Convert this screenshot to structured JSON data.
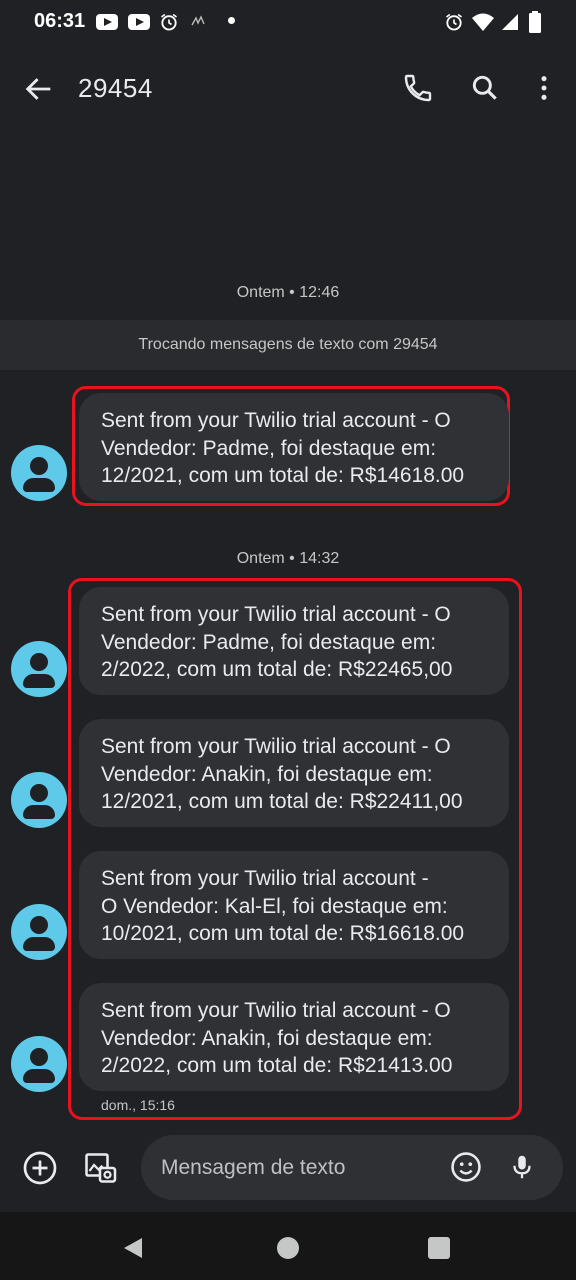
{
  "status_bar": {
    "time": "06:31"
  },
  "header": {
    "title": "29454"
  },
  "thread": {
    "timestamp_1": "Ontem • 12:46",
    "banner": "Trocando mensagens de texto com 29454",
    "timestamp_2": "Ontem • 14:32",
    "messages": [
      {
        "line1": "Sent from your Twilio trial account - O",
        "line2": "Vendedor: Padme, foi destaque em:",
        "line3": "12/2021, com um total de: R$14618.00"
      },
      {
        "line1": "Sent from your Twilio trial account - O",
        "line2": "Vendedor: Padme, foi destaque em:",
        "line3": "2/2022, com um total de: R$22465,00"
      },
      {
        "line1": "Sent from your Twilio trial account - O",
        "line2": "Vendedor: Anakin, foi destaque em:",
        "line3": "12/2021, com um total de: R$22411,00"
      },
      {
        "line1": "Sent from your Twilio trial account -",
        "line2": "O Vendedor: Kal-El, foi destaque em:",
        "line3": "10/2021, com um total de: R$16618.00"
      },
      {
        "line1": "Sent from your Twilio trial account - O",
        "line2": "Vendedor: Anakin, foi destaque em:",
        "line3": "2/2022, com um total de: R$21413.00"
      }
    ],
    "last_message_time": "dom., 15:16"
  },
  "compose": {
    "placeholder": "Mensagem de texto"
  },
  "colors": {
    "background": "#202124",
    "bubble": "#303134",
    "avatar": "#5ec9e8",
    "highlight": "#e8131f"
  },
  "icons": [
    "back-arrow-icon",
    "phone-icon",
    "search-icon",
    "more-vert-icon",
    "add-icon",
    "gallery-icon",
    "emoji-icon",
    "mic-icon",
    "youtube-icon",
    "alarm-icon",
    "wifi-icon",
    "signal-icon",
    "battery-icon"
  ]
}
